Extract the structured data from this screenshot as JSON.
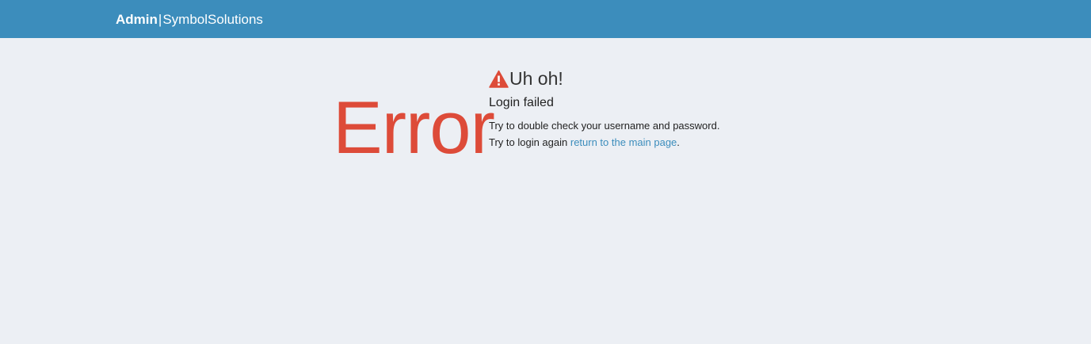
{
  "header": {
    "brand_bold": "Admin",
    "brand_separator": "|",
    "brand_light": "SymbolSolutions",
    "background_color": "#3c8dbc"
  },
  "error": {
    "code_text": "Error",
    "code_color": "#dd4b39",
    "icon": "warning-triangle-icon",
    "headline": "Uh oh!",
    "title": "Login failed",
    "line1": "Try to double check your username and password.",
    "line2_prefix": "Try to login again ",
    "link_text": "return to the main page",
    "line2_suffix": "."
  }
}
